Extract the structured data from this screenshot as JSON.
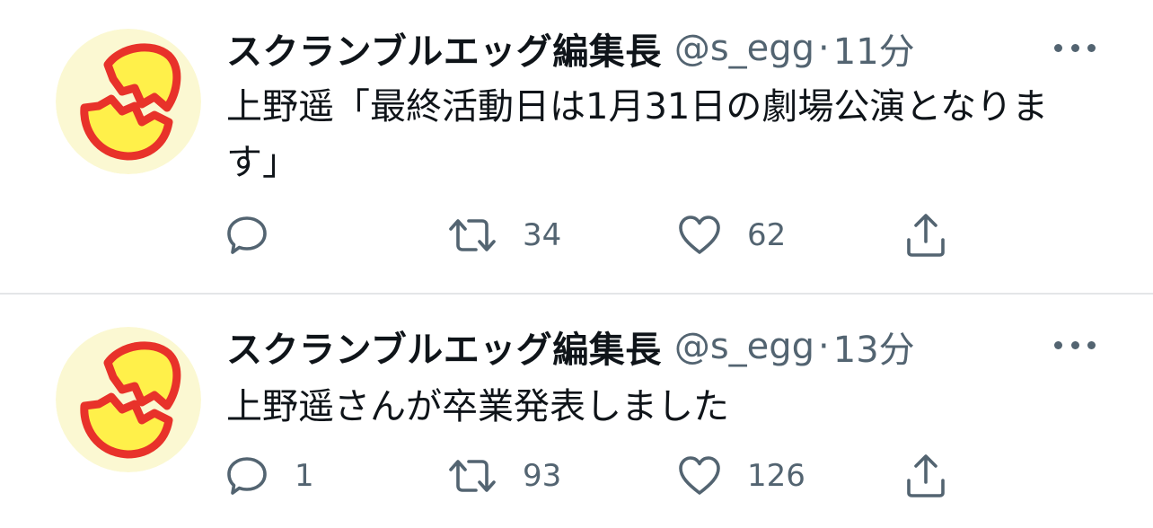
{
  "tweets": [
    {
      "display_name": "スクランブルエッグ編集長",
      "handle": "@s_egg",
      "separator": "·",
      "time": "11分",
      "text": "上野遥「最終活動日は1月31日の劇場公演となります」",
      "reply_count": "",
      "retweet_count": "34",
      "like_count": "62"
    },
    {
      "display_name": "スクランブルエッグ編集長",
      "handle": "@s_egg",
      "separator": "·",
      "time": "13分",
      "text": "上野遥さんが卒業発表しました",
      "reply_count": "1",
      "retweet_count": "93",
      "like_count": "126"
    }
  ],
  "icons": {
    "reply": "reply-icon",
    "retweet": "retweet-icon",
    "like": "heart-icon",
    "share": "share-icon",
    "more": "more-icon"
  },
  "colors": {
    "text": "#0f1419",
    "secondary": "#536471",
    "divider": "#e4e6e8",
    "avatar_bg": "#fbf8d2",
    "egg_yellow": "#fff04a",
    "egg_red": "#e8322a"
  }
}
